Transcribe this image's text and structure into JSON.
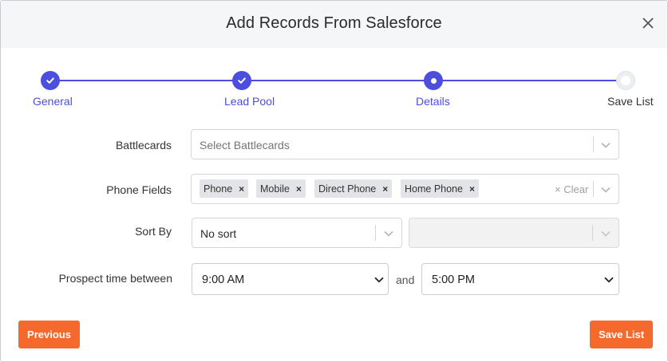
{
  "dialog": {
    "title": "Add Records From Salesforce",
    "close_icon": "close-icon"
  },
  "colors": {
    "accent": "#4c4ee0",
    "button": "#f5692d",
    "header_bg": "#f5f6f8"
  },
  "stepper": {
    "steps": [
      {
        "label": "General",
        "state": "complete",
        "icon": "check-icon"
      },
      {
        "label": "Lead Pool",
        "state": "complete",
        "icon": "check-icon"
      },
      {
        "label": "Details",
        "state": "current",
        "icon": "dot-icon"
      },
      {
        "label": "Save List",
        "state": "pending",
        "icon": "circle-icon"
      }
    ]
  },
  "form": {
    "battlecards": {
      "label": "Battlecards",
      "placeholder": "Select Battlecards"
    },
    "phone_fields": {
      "label": "Phone Fields",
      "tags": [
        "Phone",
        "Mobile",
        "Direct Phone",
        "Home Phone"
      ],
      "tag_remove_glyph": "×",
      "clear_label": "× Clear"
    },
    "sort_by": {
      "label": "Sort By",
      "value": "No sort",
      "secondary_value": ""
    },
    "prospect_time": {
      "label": "Prospect time between",
      "start": "9:00 AM",
      "connector": "and",
      "end": "5:00 PM"
    }
  },
  "footer": {
    "previous_label": "Previous",
    "save_label": "Save List"
  }
}
